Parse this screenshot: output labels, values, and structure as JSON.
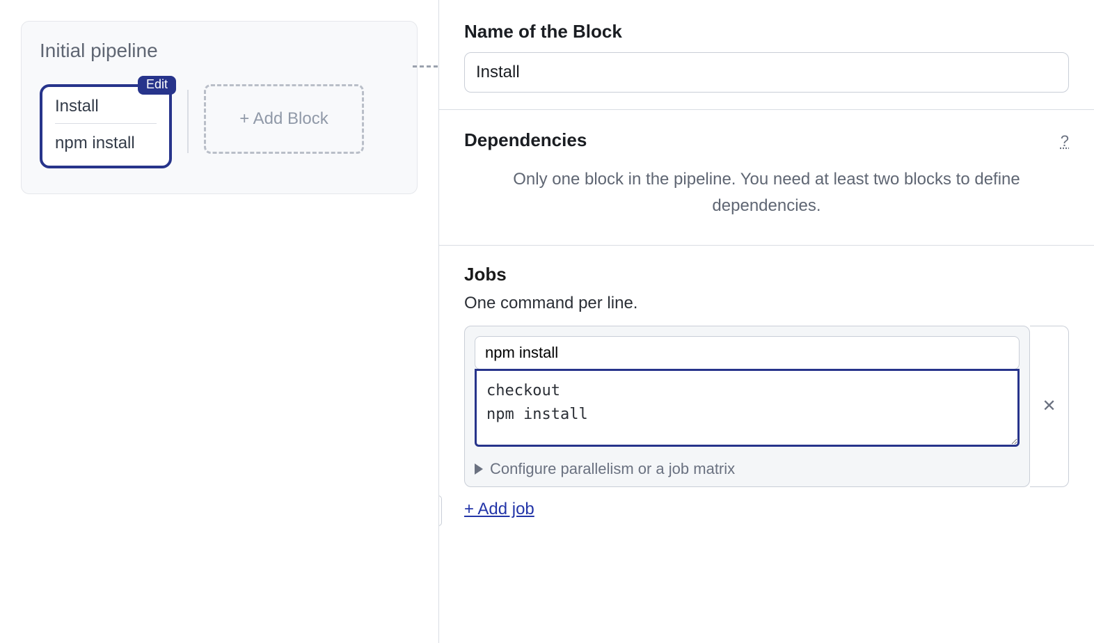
{
  "pipeline": {
    "title": "Initial pipeline",
    "block": {
      "edit_badge": "Edit",
      "name": "Install",
      "job_label": "npm install"
    },
    "add_block_label": "+ Add Block"
  },
  "right": {
    "name_field": {
      "label": "Name of the Block",
      "value": "Install"
    },
    "dependencies": {
      "title": "Dependencies",
      "help_glyph": "?",
      "message": "Only one block in the pipeline. You need at least two blocks to define dependencies."
    },
    "jobs": {
      "title": "Jobs",
      "subtitle": "One command per line.",
      "job": {
        "name": "npm install",
        "commands": "checkout\nnpm install",
        "remove_glyph": "✕",
        "configure_label": "Configure parallelism or a job matrix"
      },
      "add_job_label": "+ Add job"
    }
  }
}
